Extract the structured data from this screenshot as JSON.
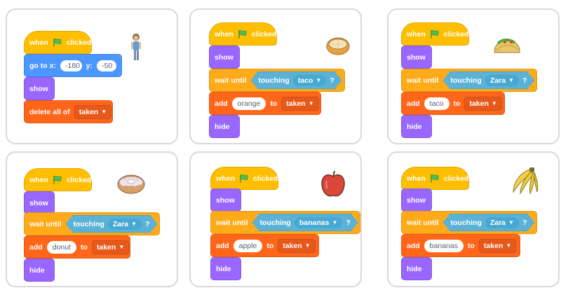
{
  "panels": [
    {
      "sprite_icon": "boy-icon",
      "when": "when",
      "clicked": "clicked",
      "goto_label": "go to x:",
      "x": "-180",
      "y_label": "y:",
      "y": "-50",
      "show": "show",
      "delete_label": "delete all of",
      "list": "taken"
    },
    {
      "sprite_icon": "orange-icon",
      "when": "when",
      "clicked": "clicked",
      "show": "show",
      "wait": "wait until",
      "touching": "touching",
      "target": "taco",
      "add": "add",
      "item": "orange",
      "to": "to",
      "list": "taken",
      "hide": "hide"
    },
    {
      "sprite_icon": "taco-icon",
      "when": "when",
      "clicked": "clicked",
      "show": "show",
      "wait": "wait until",
      "touching": "touching",
      "target": "Zara",
      "add": "add",
      "item": "taco",
      "to": "to",
      "list": "taken",
      "hide": "hide"
    },
    {
      "sprite_icon": "donut-icon",
      "when": "when",
      "clicked": "clicked",
      "show": "show",
      "wait": "wait until",
      "touching": "touching",
      "target": "Zara",
      "add": "add",
      "item": "donut",
      "to": "to",
      "list": "taken",
      "hide": "hide"
    },
    {
      "sprite_icon": "apple-icon",
      "when": "when",
      "clicked": "clicked",
      "show": "show",
      "wait": "wait until",
      "touching": "touching",
      "target": "bananas",
      "add": "add",
      "item": "apple",
      "to": "to",
      "list": "taken",
      "hide": "hide"
    },
    {
      "sprite_icon": "bananas-icon",
      "when": "when",
      "clicked": "clicked",
      "show": "show",
      "wait": "wait until",
      "touching": "touching",
      "target": "Zara",
      "add": "add",
      "item": "bananas",
      "to": "to",
      "list": "taken",
      "hide": "hide"
    }
  ],
  "question_mark": "?",
  "colors": {
    "events": "#ffbf00",
    "motion": "#4c97ff",
    "looks": "#9966ff",
    "control": "#ffab19",
    "variables": "#ff661a",
    "sensing": "#5cb1d6"
  }
}
